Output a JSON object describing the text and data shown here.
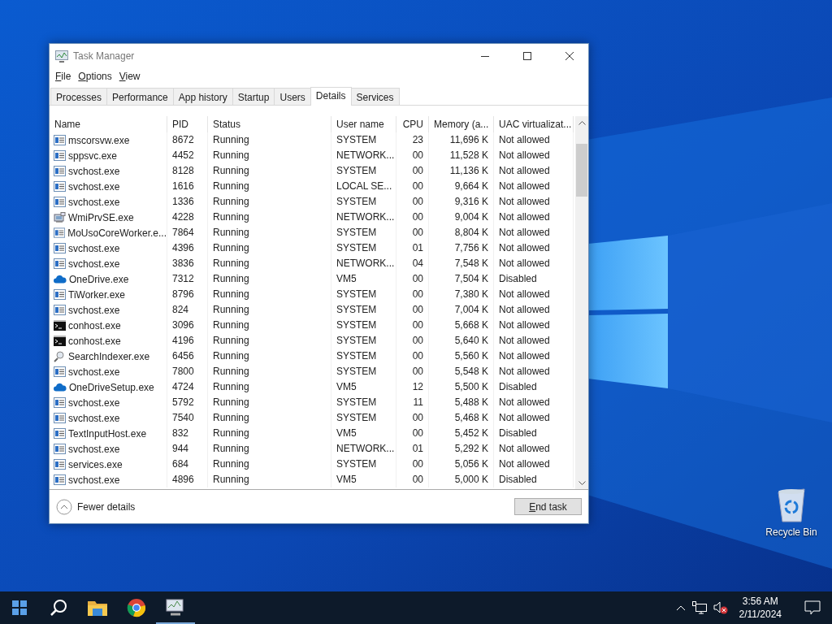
{
  "window": {
    "title": "Task Manager"
  },
  "menu": [
    "File",
    "Options",
    "View"
  ],
  "tabs": [
    {
      "label": "Processes",
      "selected": false
    },
    {
      "label": "Performance",
      "selected": false
    },
    {
      "label": "App history",
      "selected": false
    },
    {
      "label": "Startup",
      "selected": false
    },
    {
      "label": "Users",
      "selected": false
    },
    {
      "label": "Details",
      "selected": true
    },
    {
      "label": "Services",
      "selected": false
    }
  ],
  "table": {
    "columns": [
      "Name",
      "PID",
      "Status",
      "User name",
      "CPU",
      "Memory (a...",
      "UAC virtualizat..."
    ],
    "rows": [
      {
        "kind": "service",
        "cells": [
          "mscorsvw.exe",
          "8672",
          "Running",
          "SYSTEM",
          "23",
          "11,696 K",
          "Not allowed"
        ]
      },
      {
        "kind": "service",
        "cells": [
          "sppsvc.exe",
          "4452",
          "Running",
          "NETWORK...",
          "00",
          "11,528 K",
          "Not allowed"
        ]
      },
      {
        "kind": "service",
        "cells": [
          "svchost.exe",
          "8128",
          "Running",
          "SYSTEM",
          "00",
          "11,136 K",
          "Not allowed"
        ]
      },
      {
        "kind": "service",
        "cells": [
          "svchost.exe",
          "1616",
          "Running",
          "LOCAL SE...",
          "00",
          "9,664 K",
          "Not allowed"
        ]
      },
      {
        "kind": "service",
        "cells": [
          "svchost.exe",
          "1336",
          "Running",
          "SYSTEM",
          "00",
          "9,316 K",
          "Not allowed"
        ]
      },
      {
        "kind": "wmi",
        "cells": [
          "WmiPrvSE.exe",
          "4228",
          "Running",
          "NETWORK...",
          "00",
          "9,004 K",
          "Not allowed"
        ]
      },
      {
        "kind": "service",
        "cells": [
          "MoUsoCoreWorker.e...",
          "7864",
          "Running",
          "SYSTEM",
          "00",
          "8,804 K",
          "Not allowed"
        ]
      },
      {
        "kind": "service",
        "cells": [
          "svchost.exe",
          "4396",
          "Running",
          "SYSTEM",
          "01",
          "7,756 K",
          "Not allowed"
        ]
      },
      {
        "kind": "service",
        "cells": [
          "svchost.exe",
          "3836",
          "Running",
          "NETWORK...",
          "04",
          "7,548 K",
          "Not allowed"
        ]
      },
      {
        "kind": "cloud",
        "cells": [
          "OneDrive.exe",
          "7312",
          "Running",
          "VM5",
          "00",
          "7,504 K",
          "Disabled"
        ]
      },
      {
        "kind": "service",
        "cells": [
          "TiWorker.exe",
          "8796",
          "Running",
          "SYSTEM",
          "00",
          "7,380 K",
          "Not allowed"
        ]
      },
      {
        "kind": "service",
        "cells": [
          "svchost.exe",
          "824",
          "Running",
          "SYSTEM",
          "00",
          "7,004 K",
          "Not allowed"
        ]
      },
      {
        "kind": "console",
        "cells": [
          "conhost.exe",
          "3096",
          "Running",
          "SYSTEM",
          "00",
          "5,668 K",
          "Not allowed"
        ]
      },
      {
        "kind": "console",
        "cells": [
          "conhost.exe",
          "4196",
          "Running",
          "SYSTEM",
          "00",
          "5,640 K",
          "Not allowed"
        ]
      },
      {
        "kind": "search",
        "cells": [
          "SearchIndexer.exe",
          "6456",
          "Running",
          "SYSTEM",
          "00",
          "5,560 K",
          "Not allowed"
        ]
      },
      {
        "kind": "service",
        "cells": [
          "svchost.exe",
          "7800",
          "Running",
          "SYSTEM",
          "00",
          "5,548 K",
          "Not allowed"
        ]
      },
      {
        "kind": "cloud",
        "cells": [
          "OneDriveSetup.exe",
          "4724",
          "Running",
          "VM5",
          "12",
          "5,500 K",
          "Disabled"
        ]
      },
      {
        "kind": "service",
        "cells": [
          "svchost.exe",
          "5792",
          "Running",
          "SYSTEM",
          "11",
          "5,488 K",
          "Not allowed"
        ]
      },
      {
        "kind": "service",
        "cells": [
          "svchost.exe",
          "7540",
          "Running",
          "SYSTEM",
          "00",
          "5,468 K",
          "Not allowed"
        ]
      },
      {
        "kind": "service",
        "cells": [
          "TextInputHost.exe",
          "832",
          "Running",
          "VM5",
          "00",
          "5,452 K",
          "Disabled"
        ]
      },
      {
        "kind": "service",
        "cells": [
          "svchost.exe",
          "944",
          "Running",
          "NETWORK...",
          "01",
          "5,292 K",
          "Not allowed"
        ]
      },
      {
        "kind": "service",
        "cells": [
          "services.exe",
          "684",
          "Running",
          "SYSTEM",
          "00",
          "5,056 K",
          "Not allowed"
        ]
      },
      {
        "kind": "service",
        "cells": [
          "svchost.exe",
          "4896",
          "Running",
          "VM5",
          "00",
          "5,000 K",
          "Disabled"
        ]
      }
    ]
  },
  "footer": {
    "toggle": "Fewer details",
    "button": "End task"
  },
  "desktop": {
    "icons": [
      {
        "label": "Recycle Bin"
      }
    ]
  },
  "taskbar": {
    "time": "3:56 AM",
    "date": "2/11/2024"
  }
}
